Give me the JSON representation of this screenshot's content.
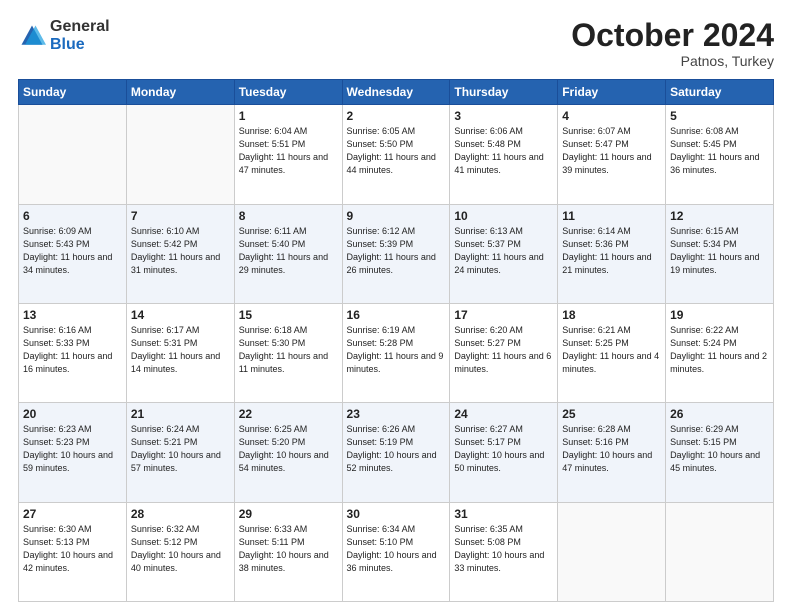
{
  "header": {
    "logo_general": "General",
    "logo_blue": "Blue",
    "month": "October 2024",
    "location": "Patnos, Turkey"
  },
  "weekdays": [
    "Sunday",
    "Monday",
    "Tuesday",
    "Wednesday",
    "Thursday",
    "Friday",
    "Saturday"
  ],
  "weeks": [
    [
      {
        "day": "",
        "info": ""
      },
      {
        "day": "",
        "info": ""
      },
      {
        "day": "1",
        "info": "Sunrise: 6:04 AM\nSunset: 5:51 PM\nDaylight: 11 hours and 47 minutes."
      },
      {
        "day": "2",
        "info": "Sunrise: 6:05 AM\nSunset: 5:50 PM\nDaylight: 11 hours and 44 minutes."
      },
      {
        "day": "3",
        "info": "Sunrise: 6:06 AM\nSunset: 5:48 PM\nDaylight: 11 hours and 41 minutes."
      },
      {
        "day": "4",
        "info": "Sunrise: 6:07 AM\nSunset: 5:47 PM\nDaylight: 11 hours and 39 minutes."
      },
      {
        "day": "5",
        "info": "Sunrise: 6:08 AM\nSunset: 5:45 PM\nDaylight: 11 hours and 36 minutes."
      }
    ],
    [
      {
        "day": "6",
        "info": "Sunrise: 6:09 AM\nSunset: 5:43 PM\nDaylight: 11 hours and 34 minutes."
      },
      {
        "day": "7",
        "info": "Sunrise: 6:10 AM\nSunset: 5:42 PM\nDaylight: 11 hours and 31 minutes."
      },
      {
        "day": "8",
        "info": "Sunrise: 6:11 AM\nSunset: 5:40 PM\nDaylight: 11 hours and 29 minutes."
      },
      {
        "day": "9",
        "info": "Sunrise: 6:12 AM\nSunset: 5:39 PM\nDaylight: 11 hours and 26 minutes."
      },
      {
        "day": "10",
        "info": "Sunrise: 6:13 AM\nSunset: 5:37 PM\nDaylight: 11 hours and 24 minutes."
      },
      {
        "day": "11",
        "info": "Sunrise: 6:14 AM\nSunset: 5:36 PM\nDaylight: 11 hours and 21 minutes."
      },
      {
        "day": "12",
        "info": "Sunrise: 6:15 AM\nSunset: 5:34 PM\nDaylight: 11 hours and 19 minutes."
      }
    ],
    [
      {
        "day": "13",
        "info": "Sunrise: 6:16 AM\nSunset: 5:33 PM\nDaylight: 11 hours and 16 minutes."
      },
      {
        "day": "14",
        "info": "Sunrise: 6:17 AM\nSunset: 5:31 PM\nDaylight: 11 hours and 14 minutes."
      },
      {
        "day": "15",
        "info": "Sunrise: 6:18 AM\nSunset: 5:30 PM\nDaylight: 11 hours and 11 minutes."
      },
      {
        "day": "16",
        "info": "Sunrise: 6:19 AM\nSunset: 5:28 PM\nDaylight: 11 hours and 9 minutes."
      },
      {
        "day": "17",
        "info": "Sunrise: 6:20 AM\nSunset: 5:27 PM\nDaylight: 11 hours and 6 minutes."
      },
      {
        "day": "18",
        "info": "Sunrise: 6:21 AM\nSunset: 5:25 PM\nDaylight: 11 hours and 4 minutes."
      },
      {
        "day": "19",
        "info": "Sunrise: 6:22 AM\nSunset: 5:24 PM\nDaylight: 11 hours and 2 minutes."
      }
    ],
    [
      {
        "day": "20",
        "info": "Sunrise: 6:23 AM\nSunset: 5:23 PM\nDaylight: 10 hours and 59 minutes."
      },
      {
        "day": "21",
        "info": "Sunrise: 6:24 AM\nSunset: 5:21 PM\nDaylight: 10 hours and 57 minutes."
      },
      {
        "day": "22",
        "info": "Sunrise: 6:25 AM\nSunset: 5:20 PM\nDaylight: 10 hours and 54 minutes."
      },
      {
        "day": "23",
        "info": "Sunrise: 6:26 AM\nSunset: 5:19 PM\nDaylight: 10 hours and 52 minutes."
      },
      {
        "day": "24",
        "info": "Sunrise: 6:27 AM\nSunset: 5:17 PM\nDaylight: 10 hours and 50 minutes."
      },
      {
        "day": "25",
        "info": "Sunrise: 6:28 AM\nSunset: 5:16 PM\nDaylight: 10 hours and 47 minutes."
      },
      {
        "day": "26",
        "info": "Sunrise: 6:29 AM\nSunset: 5:15 PM\nDaylight: 10 hours and 45 minutes."
      }
    ],
    [
      {
        "day": "27",
        "info": "Sunrise: 6:30 AM\nSunset: 5:13 PM\nDaylight: 10 hours and 42 minutes."
      },
      {
        "day": "28",
        "info": "Sunrise: 6:32 AM\nSunset: 5:12 PM\nDaylight: 10 hours and 40 minutes."
      },
      {
        "day": "29",
        "info": "Sunrise: 6:33 AM\nSunset: 5:11 PM\nDaylight: 10 hours and 38 minutes."
      },
      {
        "day": "30",
        "info": "Sunrise: 6:34 AM\nSunset: 5:10 PM\nDaylight: 10 hours and 36 minutes."
      },
      {
        "day": "31",
        "info": "Sunrise: 6:35 AM\nSunset: 5:08 PM\nDaylight: 10 hours and 33 minutes."
      },
      {
        "day": "",
        "info": ""
      },
      {
        "day": "",
        "info": ""
      }
    ]
  ]
}
